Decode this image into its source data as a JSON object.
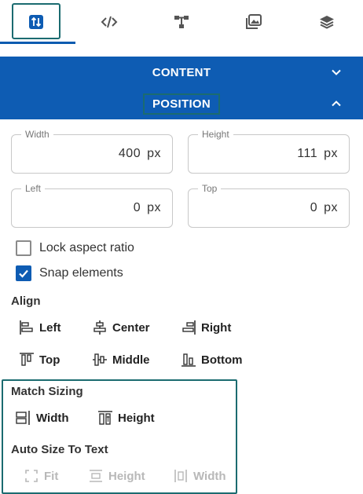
{
  "tabs": [
    {
      "name": "layout-tab",
      "icon": "sort-arrows-icon",
      "active": true
    },
    {
      "name": "code-tab",
      "icon": "code-icon",
      "active": false
    },
    {
      "name": "structure-tab",
      "icon": "hierarchy-icon",
      "active": false
    },
    {
      "name": "media-tab",
      "icon": "images-icon",
      "active": false
    },
    {
      "name": "layers-tab",
      "icon": "layers-icon",
      "active": false
    }
  ],
  "sections": {
    "content": {
      "label": "CONTENT",
      "expanded": false
    },
    "position": {
      "label": "POSITION",
      "expanded": true
    }
  },
  "fields": {
    "width": {
      "label": "Width",
      "value": "400",
      "unit": "px"
    },
    "height": {
      "label": "Height",
      "value": "111",
      "unit": "px"
    },
    "left": {
      "label": "Left",
      "value": "0",
      "unit": "px"
    },
    "top": {
      "label": "Top",
      "value": "0",
      "unit": "px"
    }
  },
  "checkboxes": {
    "lock_aspect": {
      "label": "Lock aspect ratio",
      "checked": false
    },
    "snap_elements": {
      "label": "Snap elements",
      "checked": true
    }
  },
  "align": {
    "heading": "Align",
    "left": "Left",
    "center": "Center",
    "right": "Right",
    "top": "Top",
    "middle": "Middle",
    "bottom": "Bottom"
  },
  "match_sizing": {
    "heading": "Match Sizing",
    "width": "Width",
    "height": "Height"
  },
  "auto_size": {
    "heading": "Auto Size To Text",
    "fit": "Fit",
    "height": "Height",
    "width": "Width"
  },
  "colors": {
    "accent": "#0e5cb3",
    "highlight": "#1b6b70",
    "disabled": "#b8b8b8"
  }
}
